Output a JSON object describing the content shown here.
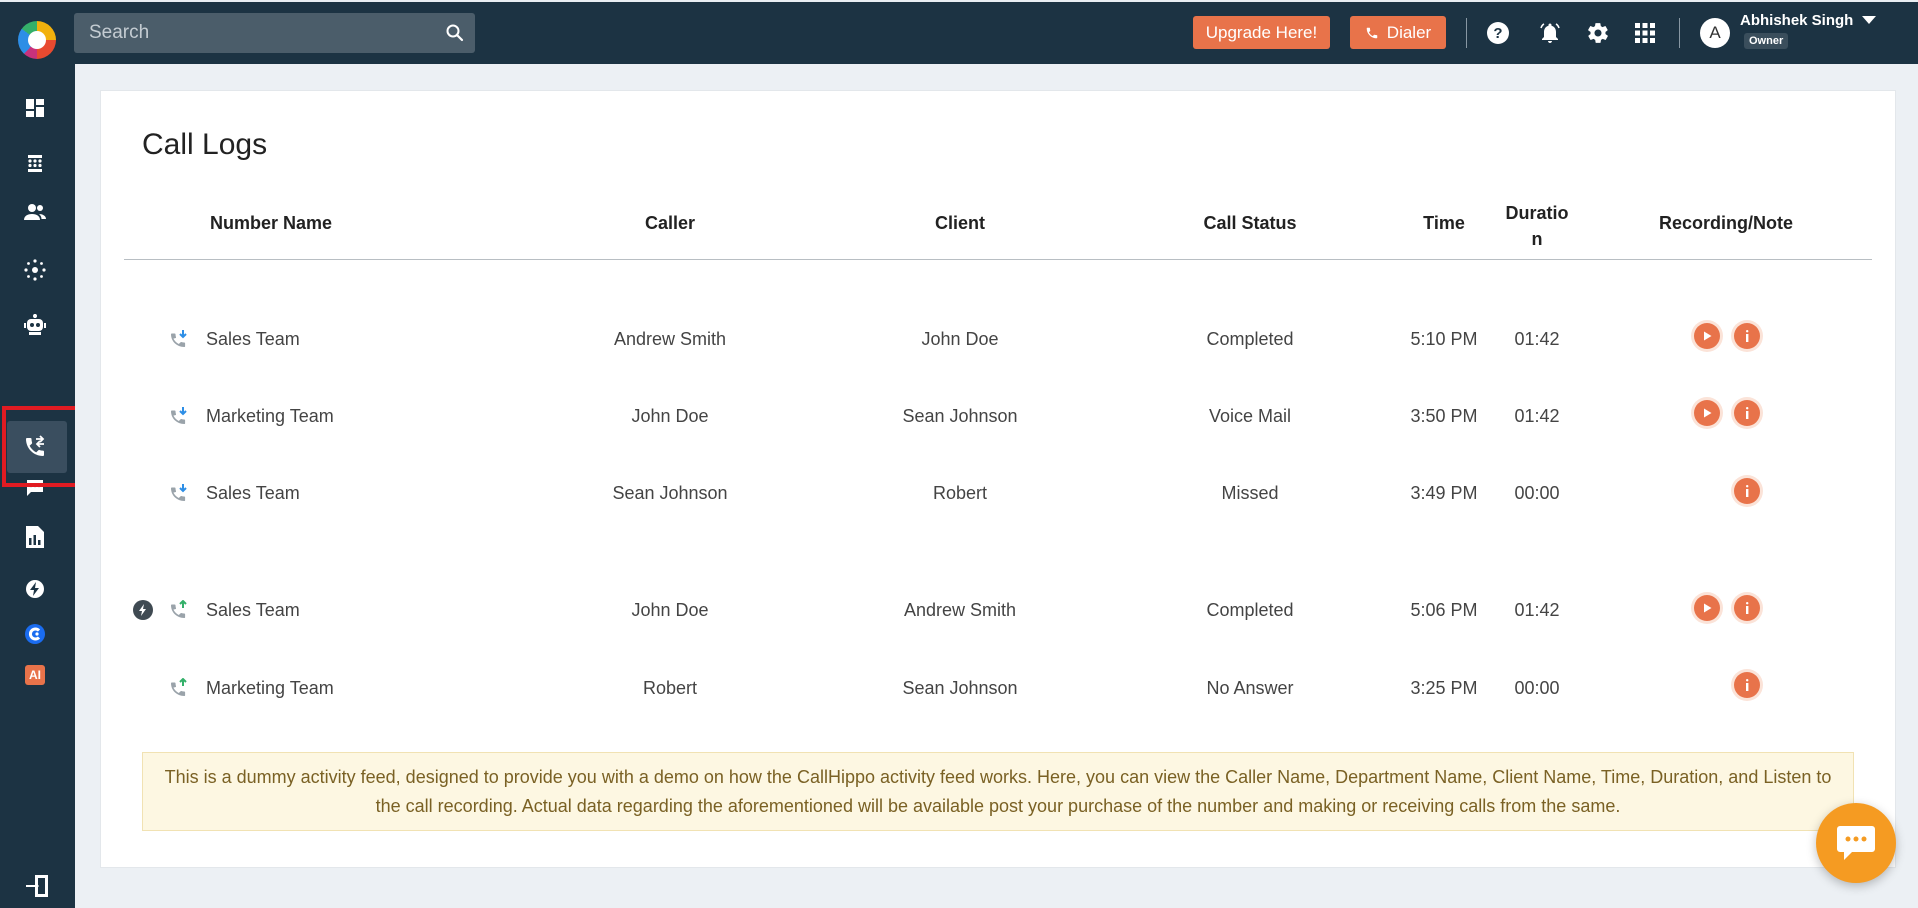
{
  "search": {
    "placeholder": "Search"
  },
  "header": {
    "upgrade_label": "Upgrade Here!",
    "dialer_label": "Dialer",
    "user": {
      "initial": "A",
      "name": "Abhishek Singh",
      "role": "Owner"
    }
  },
  "sidebar": {
    "items": [
      "dashboard",
      "numbers",
      "users",
      "integrations",
      "bot",
      "call-logs",
      "messages",
      "reports",
      "power-dialer",
      "extension",
      "ai"
    ],
    "active": "call-logs",
    "ai_label": "AI"
  },
  "page": {
    "title": "Call Logs"
  },
  "table": {
    "headers": {
      "number_name": "Number Name",
      "caller": "Caller",
      "client": "Client",
      "call_status": "Call Status",
      "time": "Time",
      "duration_1": "Duratio",
      "duration_2": "n",
      "recording_note": "Recording/Note"
    },
    "rows": [
      {
        "direction": "incoming",
        "number_name": "Sales Team",
        "caller": "Andrew Smith",
        "client": "John Doe",
        "status": "Completed",
        "time": "5:10 PM",
        "duration": "01:42",
        "has_recording": true
      },
      {
        "direction": "incoming",
        "number_name": "Marketing Team",
        "caller": "John Doe",
        "client": "Sean Johnson",
        "status": "Voice Mail",
        "time": "3:50 PM",
        "duration": "01:42",
        "has_recording": true
      },
      {
        "direction": "incoming",
        "number_name": "Sales Team",
        "caller": "Sean Johnson",
        "client": "Robert",
        "status": "Missed",
        "time": "3:49 PM",
        "duration": "00:00",
        "has_recording": false
      },
      {
        "direction": "outgoing",
        "power_dialer": true,
        "number_name": "Sales Team",
        "caller": "John Doe",
        "client": "Andrew Smith",
        "status": "Completed",
        "time": "5:06 PM",
        "duration": "01:42",
        "has_recording": true
      },
      {
        "direction": "outgoing",
        "number_name": "Marketing Team",
        "caller": "Robert",
        "client": "Sean Johnson",
        "status": "No Answer",
        "time": "3:25 PM",
        "duration": "00:00",
        "has_recording": false
      }
    ]
  },
  "notice": {
    "text": "This is a dummy activity feed, designed to provide you with a demo on how the CallHippo activity feed works. Here, you can view the Caller Name, Department Name, Client Name, Time, Duration, and Listen to the call recording. Actual data regarding the aforementioned will be available post your purchase of the number and making or receiving calls from the same."
  },
  "colors": {
    "accent": "#e8734a",
    "topbar": "#1c3343",
    "incoming": "#2d8ee6",
    "outgoing": "#34b06a",
    "chat": "#f59b22",
    "highlight": "#e11b22"
  }
}
